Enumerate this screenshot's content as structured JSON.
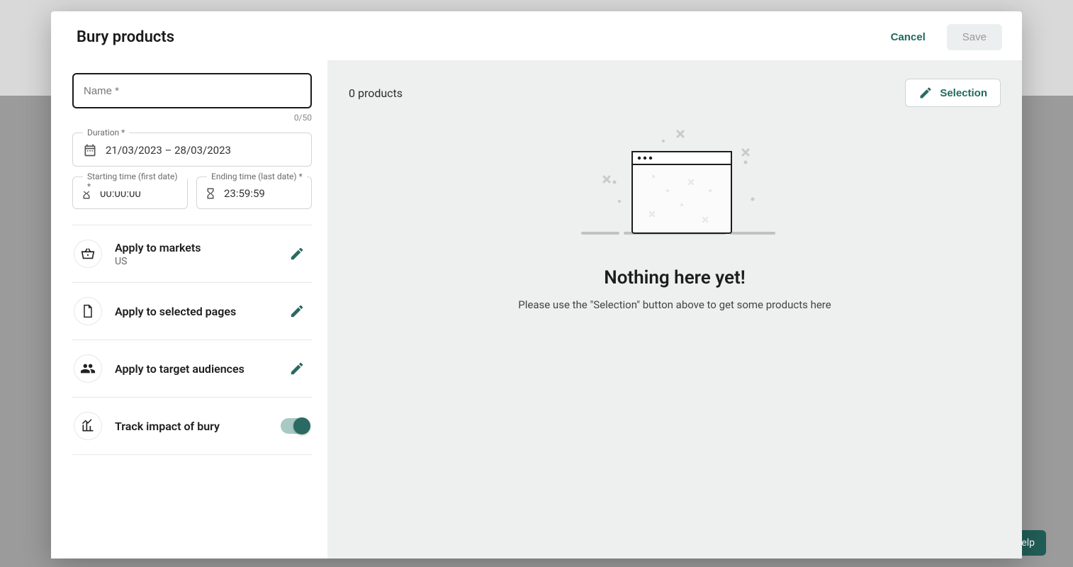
{
  "header": {
    "title": "Bury products",
    "cancel": "Cancel",
    "save": "Save"
  },
  "form": {
    "name_placeholder": "Name *",
    "char_count": "0/50",
    "duration_label": "Duration *",
    "duration_value": "21/03/2023 – 28/03/2023",
    "start_label": "Starting time (first date) *",
    "start_value": "00:00:00",
    "end_label": "Ending time (last date) *",
    "end_value": "23:59:59"
  },
  "sections": {
    "markets": {
      "title": "Apply to markets",
      "sub": "US"
    },
    "pages": {
      "title": "Apply to selected pages"
    },
    "audiences": {
      "title": "Apply to target audiences"
    },
    "track": {
      "title": "Track impact of bury"
    }
  },
  "right": {
    "count": "0 products",
    "selection": "Selection",
    "empty_title": "Nothing here yet!",
    "empty_sub": "Please use the \"Selection\" button above to get some products here"
  },
  "help": "elp"
}
